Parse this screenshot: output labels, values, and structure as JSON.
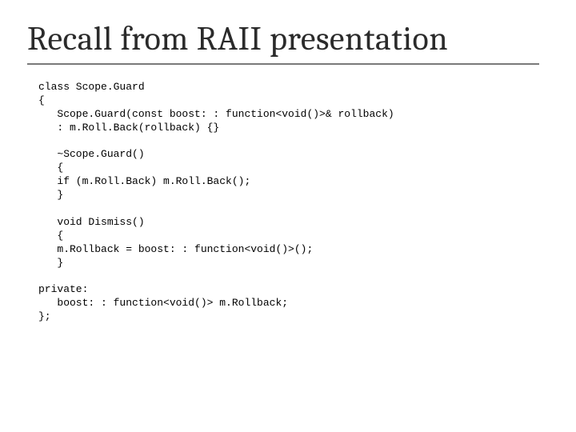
{
  "slide": {
    "title": "Recall from RAII presentation",
    "code": "class Scope.Guard\n{\n   Scope.Guard(const boost: : function<void()>& rollback)\n   : m.Roll.Back(rollback) {}\n\n   ~Scope.Guard()\n   {\n   if (m.Roll.Back) m.Roll.Back();\n   }\n\n   void Dismiss()\n   {\n   m.Rollback = boost: : function<void()>();\n   }\n\nprivate:\n   boost: : function<void()> m.Rollback;\n};"
  }
}
